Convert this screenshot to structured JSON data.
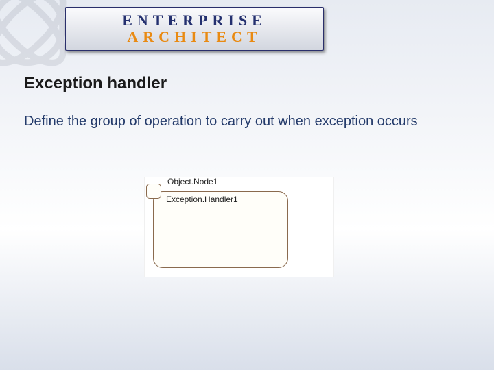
{
  "banner": {
    "line1": "ENTERPRISE",
    "line2": "ARCHITECT"
  },
  "title": "Exception handler",
  "description": "Define the group of operation to carry out when exception occurs",
  "diagram": {
    "object_node_label": "Object.Node1",
    "handler_label": "Exception.Handler1"
  }
}
